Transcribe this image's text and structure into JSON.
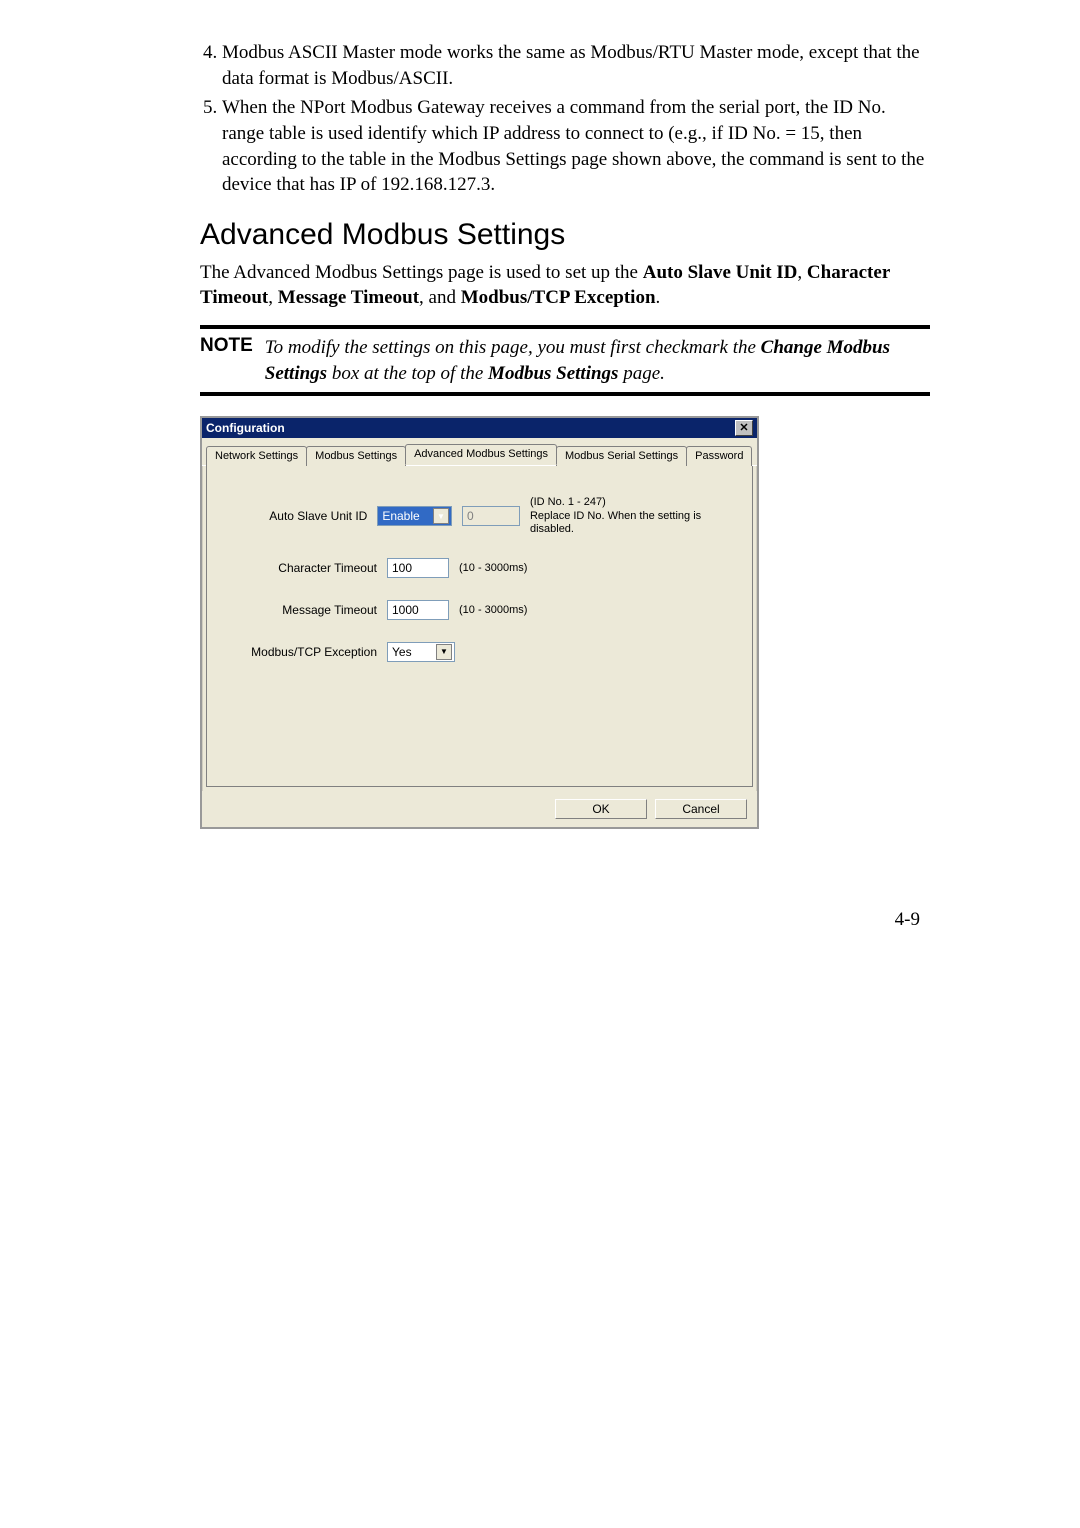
{
  "list": {
    "item4": "Modbus ASCII Master mode works the same as Modbus/RTU Master mode, except that the data format is Modbus/ASCII.",
    "item5": "When the NPort Modbus Gateway receives a command from the serial port, the ID No. range table is used identify which IP address to connect to (e.g., if ID No. = 15, then according to the table in the Modbus Settings page shown above, the command is sent to the device that has IP of 192.168.127.3."
  },
  "heading": "Advanced Modbus Settings",
  "intro_1": "The Advanced Modbus Settings page is used to set up the ",
  "intro_b1": "Auto Slave Unit ID",
  "intro_2": ", ",
  "intro_b2": "Character Timeout",
  "intro_3": ", ",
  "intro_b3": "Message Timeout",
  "intro_4": ", and ",
  "intro_b4": "Modbus/TCP Exception",
  "intro_5": ".",
  "note_label": "NOTE",
  "note_1": "To modify the settings on this page, you must first checkmark the ",
  "note_b1": "Change Modbus Settings",
  "note_2": " box at the top of the ",
  "note_b2": "Modbus Settings",
  "note_3": " page.",
  "dialog": {
    "title": "Configuration",
    "tabs": {
      "t1": "Network Settings",
      "t2": "Modbus Settings",
      "t3": "Advanced Modbus Settings",
      "t4": "Modbus Serial Settings",
      "t5": "Password"
    },
    "rows": {
      "auto_label": "Auto Slave Unit ID",
      "auto_value": "Enable",
      "auto_id": "0",
      "auto_hint1": "(ID No. 1 - 247)",
      "auto_hint2": "Replace ID No. When the setting is disabled.",
      "char_label": "Character Timeout",
      "char_value": "100",
      "char_hint": "(10 - 3000ms)",
      "msg_label": "Message Timeout",
      "msg_value": "1000",
      "msg_hint": "(10 - 3000ms)",
      "exc_label": "Modbus/TCP Exception",
      "exc_value": "Yes"
    },
    "ok": "OK",
    "cancel": "Cancel"
  },
  "pagenum": "4-9"
}
